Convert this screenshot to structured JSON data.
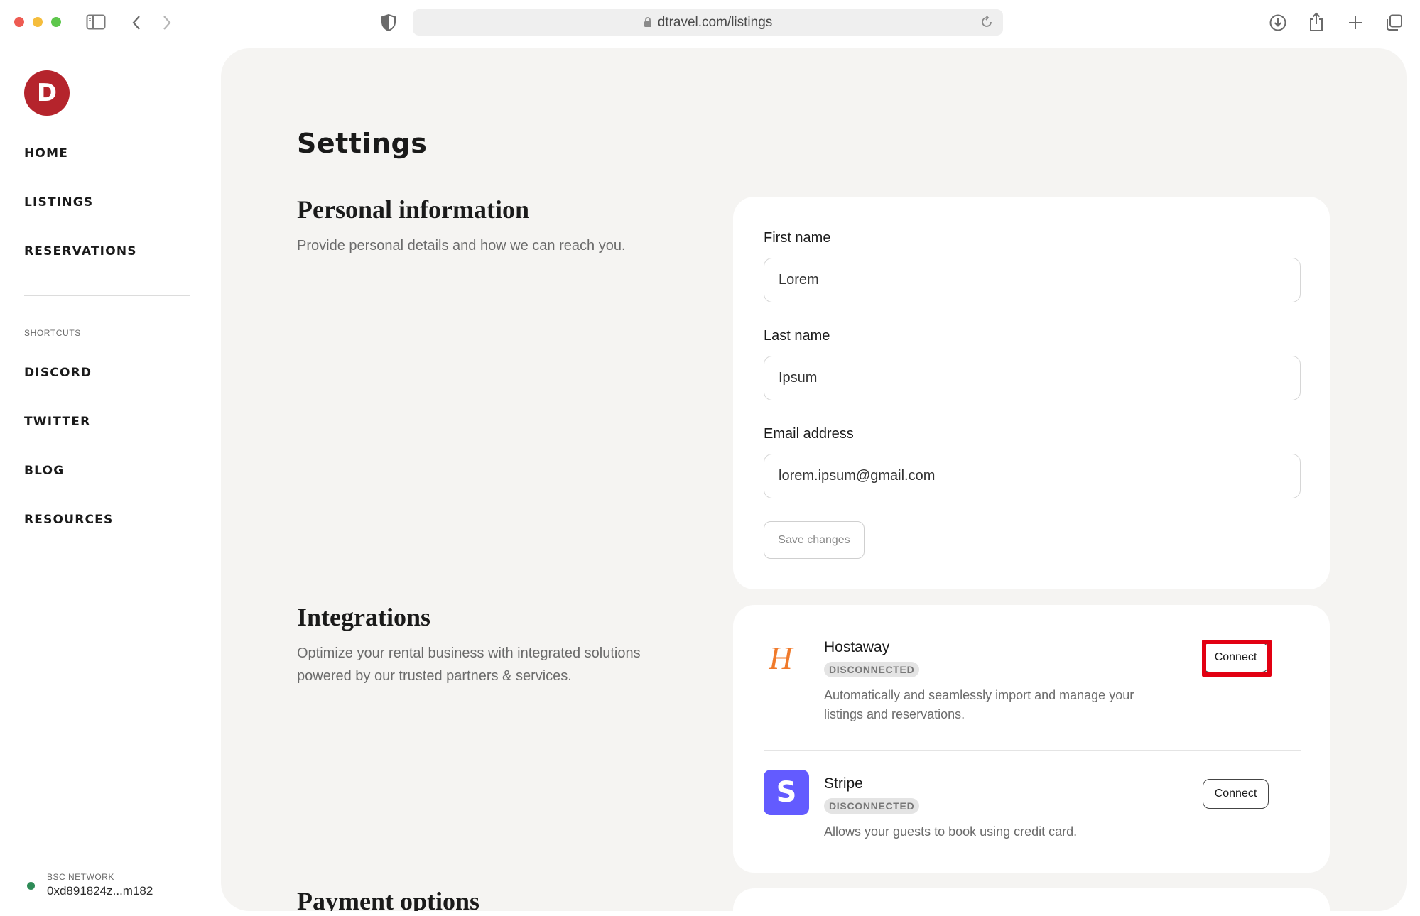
{
  "browser": {
    "url": "dtravel.com/listings"
  },
  "sidebar": {
    "logo_letter": "D",
    "nav": [
      {
        "label": "HOME"
      },
      {
        "label": "LISTINGS"
      },
      {
        "label": "RESERVATIONS"
      }
    ],
    "shortcuts_label": "SHORTCUTS",
    "shortcuts": [
      {
        "label": "DISCORD"
      },
      {
        "label": "TWITTER"
      },
      {
        "label": "BLOG"
      },
      {
        "label": "RESOURCES"
      }
    ],
    "network": {
      "label": "BSC NETWORK",
      "address": "0xd891824z...m182",
      "status_color": "#2e8b57"
    }
  },
  "main": {
    "title": "Settings",
    "personal": {
      "title": "Personal information",
      "description": "Provide personal details and how we can reach you.",
      "fields": [
        {
          "label": "First name",
          "value": "Lorem"
        },
        {
          "label": "Last name",
          "value": "Ipsum"
        },
        {
          "label": "Email address",
          "value": "lorem.ipsum@gmail.com"
        }
      ],
      "save_label": "Save changes"
    },
    "integrations": {
      "title": "Integrations",
      "description": "Optimize your rental business with integrated solutions powered by our trusted partners & services.",
      "items": [
        {
          "name": "Hostaway",
          "logo_glyph": "H",
          "logo_color": "#f07a2b",
          "status": "DISCONNECTED",
          "description": "Automatically and seamlessly import and manage your listings and reservations.",
          "button_label": "Connect"
        },
        {
          "name": "Stripe",
          "logo_glyph": "S",
          "logo_color": "#635bff",
          "status": "DISCONNECTED",
          "description": "Allows your guests to book using credit card.",
          "button_label": "Connect"
        }
      ]
    },
    "payment": {
      "title": "Payment options"
    }
  },
  "colors": {
    "brand": "#b5242c",
    "panel_bg": "#f5f4f2",
    "highlight": "#e20012"
  }
}
